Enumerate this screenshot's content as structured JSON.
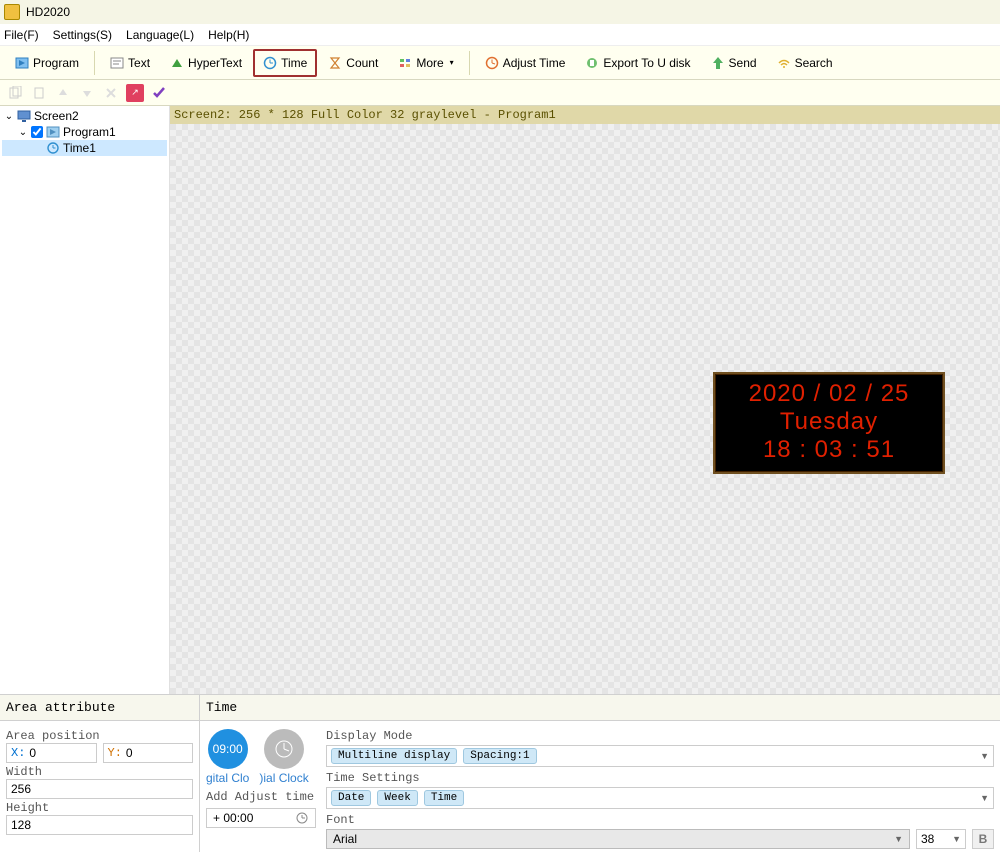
{
  "title": "HD2020",
  "menu": {
    "file": "File(F)",
    "settings": "Settings(S)",
    "language": "Language(L)",
    "help": "Help(H)"
  },
  "toolbar": {
    "program": "Program",
    "text": "Text",
    "hypertext": "HyperText",
    "time": "Time",
    "count": "Count",
    "more": "More",
    "adjust_time": "Adjust Time",
    "export_usb": "Export To U disk",
    "send": "Send",
    "search": "Search"
  },
  "tree": {
    "screen": "Screen2",
    "program": "Program1",
    "time_item": "Time1"
  },
  "canvas_header": "Screen2: 256 * 128 Full Color 32 graylevel - Program1",
  "led": {
    "date": "2020 / 02 / 25",
    "day": "Tuesday",
    "time": "18 : 03 : 51"
  },
  "area_panel": {
    "title": "Area attribute",
    "position_label": "Area position",
    "x_prefix": "X:",
    "y_prefix": "Y:",
    "x_value": "0",
    "y_value": "0",
    "width_label": "Width",
    "width_value": "256",
    "height_label": "Height",
    "height_value": "128"
  },
  "time_panel": {
    "title": "Time",
    "clock_digital_label": "gital Clo",
    "clock_digital_time": "09:00",
    "clock_dial_label": ")ial Clock",
    "adjust_label": "Add Adjust time",
    "adjust_value": "+ 00:00",
    "display_mode_label": "Display Mode",
    "dm_tag1": "Multiline display",
    "dm_tag2": "Spacing:1",
    "time_settings_label": "Time Settings",
    "ts_tag1": "Date",
    "ts_tag2": "Week",
    "ts_tag3": "Time",
    "font_label": "Font",
    "font_value": "Arial",
    "font_size": "38",
    "bold": "B"
  }
}
